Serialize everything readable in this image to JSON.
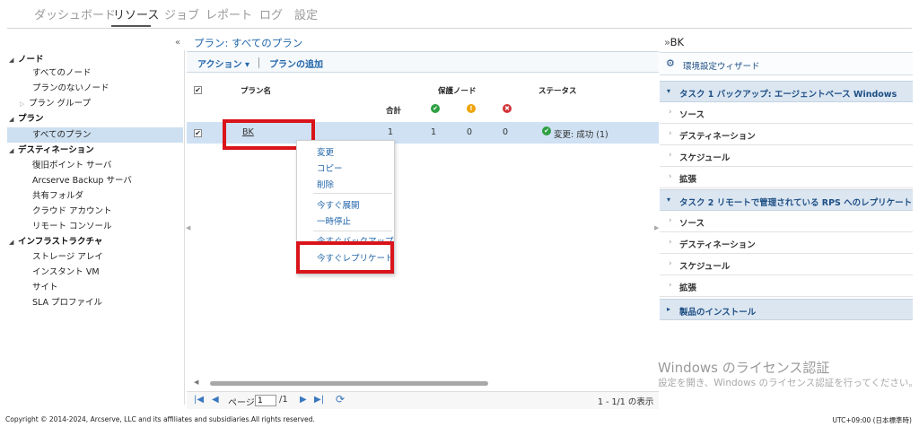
{
  "nav": {
    "items": [
      "ダッシュボード",
      "リソース",
      "ジョブ",
      "レポート",
      "ログ",
      "設定"
    ],
    "active": "リソース"
  },
  "tree": {
    "collapse_glyph": "«",
    "groups": [
      {
        "label": "ノード",
        "items": [
          "すべてのノード",
          "プランのないノード",
          "プラン グループ"
        ]
      },
      {
        "label": "プラン",
        "items": [
          "すべてのプラン"
        ]
      },
      {
        "label": "デスティネーション",
        "items": [
          "復旧ポイント サーバ",
          "Arcserve Backup サーバ",
          "共有フォルダ",
          "クラウド アカウント",
          "リモート コンソール"
        ]
      },
      {
        "label": "インフラストラクチャ",
        "items": [
          "ストレージ アレイ",
          "インスタント VM",
          "サイト",
          "SLA プロファイル"
        ]
      }
    ]
  },
  "center": {
    "title": "プラン: すべてのプラン",
    "toolbar": {
      "action": "アクション",
      "action_caret": "▾",
      "add_plan": "プランの追加"
    },
    "columns": {
      "plan_name": "プラン名",
      "protected_nodes": "保護ノード",
      "status": "ステータス",
      "total": "合計"
    },
    "status_icons": {
      "success": "✔",
      "warning": "!",
      "error": "✖"
    },
    "row": {
      "checked": "✔",
      "name": "BK",
      "total": "1",
      "success": "1",
      "warning": "0",
      "error": "0",
      "status": "変更: 成功 (1)"
    },
    "context_menu": [
      "変更",
      "コピー",
      "削除",
      "今すぐ展開",
      "一時停止",
      "今すぐバックアップ",
      "今すぐレプリケート"
    ],
    "pager": {
      "first": "|◀",
      "prev": "◀",
      "page_label": "ページ",
      "page_value": "1",
      "page_total": "/1",
      "next": "▶",
      "last": "▶|",
      "refresh": "⟳",
      "display": "1 - 1/1 の表示"
    }
  },
  "right": {
    "title": "BK",
    "expand_glyph": "»",
    "wizard": "環境設定ウィザード",
    "task1": "タスク 1 バックアップ: エージェントベース Windows",
    "task1_items": [
      "ソース",
      "デスティネーション",
      "スケジュール",
      "拡張"
    ],
    "task2": "タスク 2 リモートで管理されている RPS へのレプリケート",
    "task2_items": [
      "ソース",
      "デスティネーション",
      "スケジュール",
      "拡張"
    ],
    "install": "製品のインストール"
  },
  "watermark": {
    "line1": "Windows のライセンス認証",
    "line2": "設定を開き、Windows のライセンス認証を行ってください。"
  },
  "footer": {
    "copyright": "Copyright © 2014-2024, Arcserve, LLC and its affiliates and subsidiaries.All rights reserved.",
    "timezone": "UTC+09:00 (日本標準時)"
  },
  "colors": {
    "accent": "#2266aa",
    "highlight": "#d9141a",
    "success": "#2ea043",
    "warning": "#f0a30a",
    "error": "#d13438"
  }
}
